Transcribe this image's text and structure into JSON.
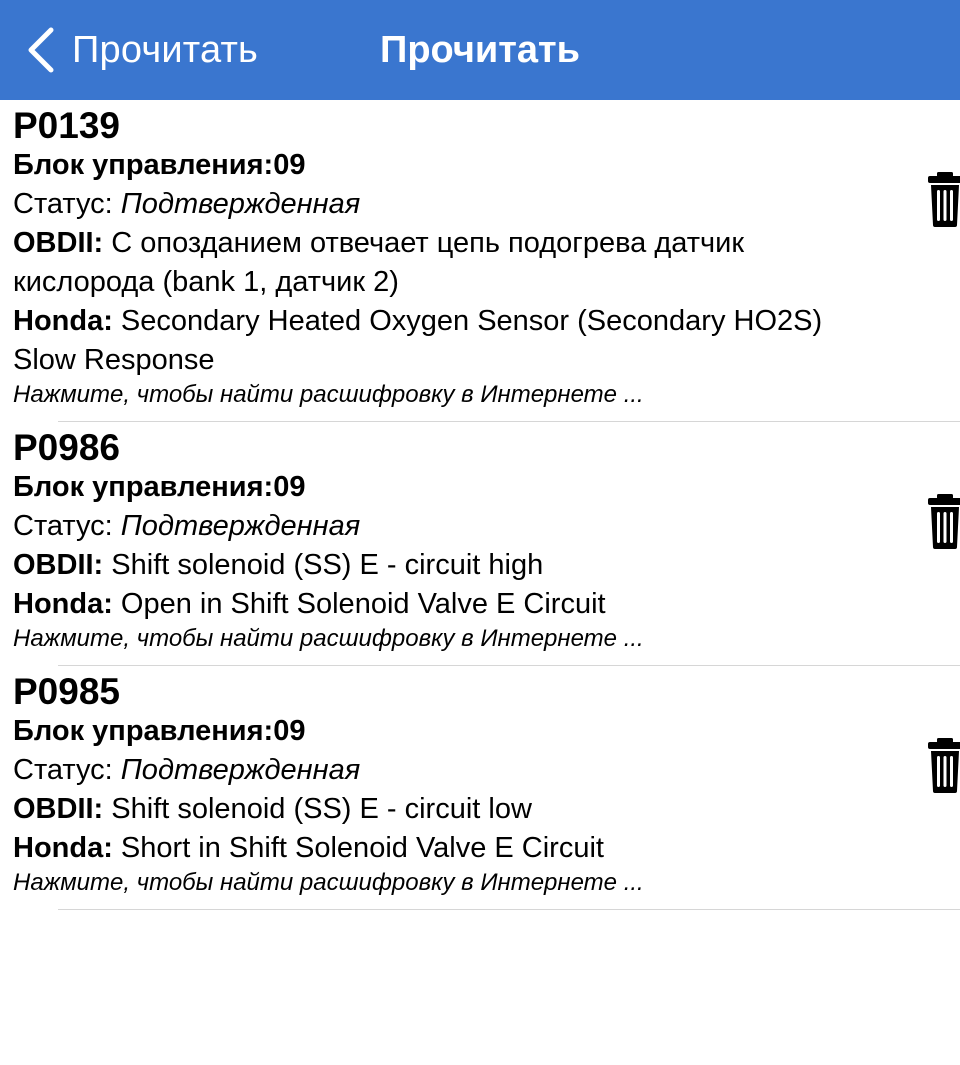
{
  "navbar": {
    "back_label": "Прочитать",
    "title": "Прочитать",
    "background": "#3a76cf"
  },
  "codes": [
    {
      "code": "P0139",
      "block_label": "Блок управления:",
      "block_value": "09",
      "status_label": "Статус: ",
      "status_value": "Подтвержденная",
      "obd_label": "OBDII:",
      "obd_text": " С опозданием отвечает цепь подогрева датчик кислорода (bank 1, датчик 2)",
      "maker_label": "Honda:",
      "maker_text": " Secondary Heated Oxygen Sensor (Secondary HO2S) Slow Response",
      "hint": "Нажмите, чтобы найти расшифровку в Интернете ..."
    },
    {
      "code": "P0986",
      "block_label": "Блок управления:",
      "block_value": "09",
      "status_label": "Статус: ",
      "status_value": "Подтвержденная",
      "obd_label": "OBDII:",
      "obd_text": " Shift solenoid (SS) E - circuit high",
      "maker_label": "Honda:",
      "maker_text": " Open in Shift Solenoid Valve E Circuit",
      "hint": "Нажмите, чтобы найти расшифровку в Интернете ..."
    },
    {
      "code": "P0985",
      "block_label": "Блок управления:",
      "block_value": "09",
      "status_label": "Статус: ",
      "status_value": "Подтвержденная",
      "obd_label": "OBDII:",
      "obd_text": " Shift solenoid (SS) E - circuit low",
      "maker_label": "Honda:",
      "maker_text": " Short in Shift Solenoid Valve E Circuit",
      "hint": "Нажмите, чтобы найти расшифровку в Интернете ..."
    }
  ],
  "icons": {
    "back": "chevron-left-icon",
    "delete": "trash-icon"
  }
}
